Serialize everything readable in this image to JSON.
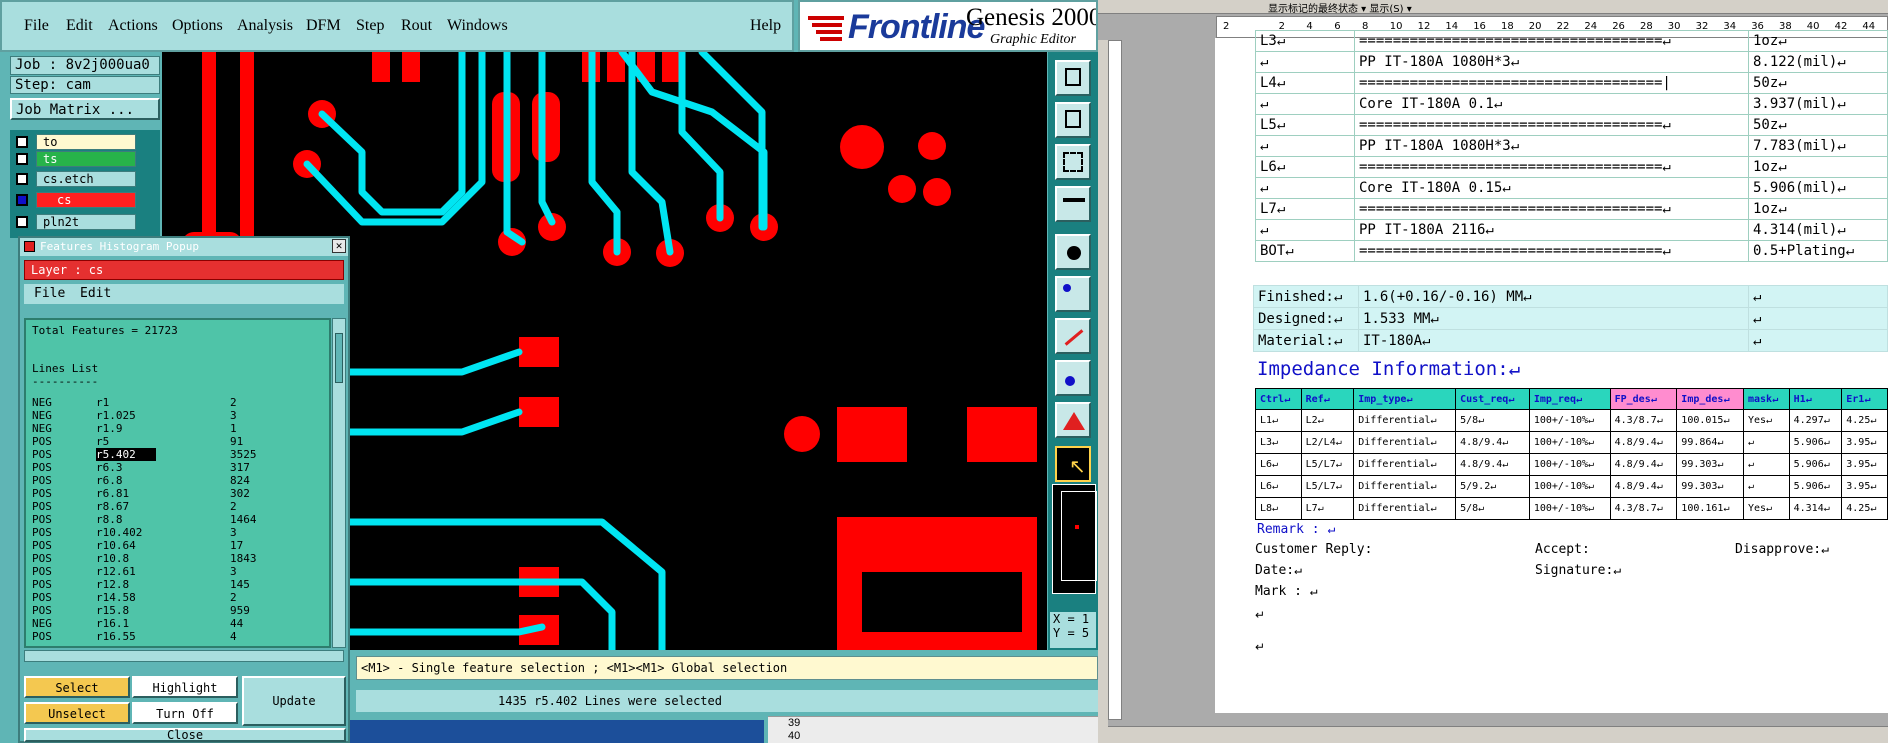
{
  "menubar": {
    "items": [
      "File",
      "Edit",
      "Actions",
      "Options",
      "Analysis",
      "DFM",
      "Step",
      "Rout",
      "Windows"
    ],
    "help": "Help"
  },
  "branding": {
    "logo": "Frontline",
    "title": "Genesis 2000",
    "subtitle": "Graphic Editor"
  },
  "job": {
    "job_label": "Job : 8v2j000ua0",
    "step_label": "Step: cam",
    "matrix_button": "Job Matrix ..."
  },
  "layers": [
    {
      "name": "to",
      "selected": false
    },
    {
      "name": "ts",
      "selected": false
    },
    {
      "name": "cs.etch",
      "selected": false
    },
    {
      "name": "cs",
      "selected": true
    },
    {
      "name": "pln2t",
      "selected": false
    }
  ],
  "popup": {
    "title": "Features Histogram Popup",
    "layer": "Layer : cs",
    "menu": [
      "File",
      "Edit"
    ],
    "total": "Total Features = 21723",
    "list_title": "Lines List",
    "list_rule": "----------",
    "rows": [
      [
        "NEG",
        "r1",
        "2"
      ],
      [
        "NEG",
        "r1.025",
        "3"
      ],
      [
        "NEG",
        "r1.9",
        "1"
      ],
      [
        "POS",
        "r5",
        "91"
      ],
      [
        "POS",
        "r5.402",
        "3525"
      ],
      [
        "POS",
        "r6.3",
        "317"
      ],
      [
        "POS",
        "r6.8",
        "824"
      ],
      [
        "POS",
        "r6.81",
        "302"
      ],
      [
        "POS",
        "r8.67",
        "2"
      ],
      [
        "POS",
        "r8.8",
        "1464"
      ],
      [
        "POS",
        "r10.402",
        "3"
      ],
      [
        "POS",
        "r10.64",
        "17"
      ],
      [
        "POS",
        "r10.8",
        "1843"
      ],
      [
        "POS",
        "r12.61",
        "3"
      ],
      [
        "POS",
        "r12.8",
        "145"
      ],
      [
        "POS",
        "r14.58",
        "2"
      ],
      [
        "POS",
        "r15.8",
        "959"
      ],
      [
        "NEG",
        "r16.1",
        "44"
      ],
      [
        "POS",
        "r16.55",
        "4"
      ]
    ],
    "selected_row": 4,
    "buttons": {
      "select": "Select",
      "highlight": "Highlight",
      "update": "Update",
      "unselect": "Unselect",
      "turn_off": "Turn Off",
      "close": "Close"
    }
  },
  "coords": {
    "x_label": "X = 1",
    "y_label": "Y = 5"
  },
  "prompt": "<M1> - Single feature selection ; <M1><M1> Global selection",
  "status": "1435 r5.402 Lines were selected",
  "sheet_rows": [
    "39",
    "40"
  ],
  "word": {
    "toolbar_text": "显示标记的最终状态 ▾  显示(S) ▾",
    "ruler_ticks": [
      "2",
      "",
      "2",
      "4",
      "6",
      "8",
      "10",
      "12",
      "14",
      "16",
      "18",
      "20",
      "22",
      "24",
      "26",
      "28",
      "30",
      "32",
      "34",
      "36",
      "38",
      "40",
      "42",
      "44"
    ],
    "stackup": [
      [
        "L3↵",
        "====================================↵",
        "1oz↵"
      ],
      [
        "↵",
        "PP     IT-180A     1080H*3↵",
        "8.122(mil)↵"
      ],
      [
        "L4↵",
        "====================================|",
        "50z↵"
      ],
      [
        "↵",
        "Core    IT-180A    0.1↵",
        "3.937(mil)↵"
      ],
      [
        "L5↵",
        "====================================↵",
        "50z↵"
      ],
      [
        "↵",
        "PP     IT-180A     1080H*3↵",
        "7.783(mil)↵"
      ],
      [
        "L6↵",
        "====================================↵",
        "1oz↵"
      ],
      [
        "↵",
        "Core    IT-180A    0.15↵",
        "5.906(mil)↵"
      ],
      [
        "L7↵",
        "====================================↵",
        "1oz↵"
      ],
      [
        "↵",
        "PP     IT-180A     2116↵",
        "4.314(mil)↵"
      ],
      [
        "BOT↵",
        "====================================↵",
        "0.5+Plating↵"
      ]
    ],
    "info": [
      [
        "Finished:↵",
        "1.6(+0.16/-0.16) MM↵",
        "↵"
      ],
      [
        "Designed:↵",
        "1.533 MM↵",
        "↵"
      ],
      [
        "Material:↵",
        "IT-180A↵",
        "↵"
      ]
    ],
    "impedance_title": "Impedance Information:↵",
    "impedance_headers": [
      "Ctrl↵",
      "Ref↵",
      "Imp_type↵",
      "Cust_req↵",
      "Imp_req↵",
      "FP_des↵",
      "Imp_des↵",
      "mask↵",
      "H1↵",
      "Er1↵"
    ],
    "impedance_rows": [
      [
        "L1↵",
        "L2↵",
        "Differential↵",
        "5/8↵",
        "100+/-10%↵",
        "4.3/8.7↵",
        "100.015↵",
        "Yes↵",
        "4.297↵",
        "4.25↵"
      ],
      [
        "L3↵",
        "L2/L4↵",
        "Differential↵",
        "4.8/9.4↵",
        "100+/-10%↵",
        "4.8/9.4↵",
        "99.864↵",
        "↵",
        "5.906↵",
        "3.95↵"
      ],
      [
        "L6↵",
        "L5/L7↵",
        "Differential↵",
        "4.8/9.4↵",
        "100+/-10%↵",
        "4.8/9.4↵",
        "99.303↵",
        "↵",
        "5.906↵",
        "3.95↵"
      ],
      [
        "L6↵",
        "L5/L7↵",
        "Differential↵",
        "5/9.2↵",
        "100+/-10%↵",
        "4.8/9.4↵",
        "99.303↵",
        "↵",
        "5.906↵",
        "3.95↵"
      ],
      [
        "L8↵",
        "L7↵",
        "Differential↵",
        "5/8↵",
        "100+/-10%↵",
        "4.3/8.7↵",
        "100.161↵",
        "Yes↵",
        "4.314↵",
        "4.25↵"
      ]
    ],
    "remark": "Remark : ↵",
    "customer_reply": "Customer Reply:",
    "accept": "Accept:",
    "disapprove": "Disapprove:↵",
    "date": "Date:↵",
    "signature": "Signature:↵",
    "mark": "Mark : ↵",
    "para_marks": [
      "↵",
      "↵"
    ]
  },
  "colors": {
    "genesis_bg": "#5fb5b5",
    "panel": "#a9dede",
    "trace_red": "#ff0000",
    "trace_cyan": "#00e5f2",
    "select_yellow": "#f4c850",
    "word_header": "#2ad6bd"
  }
}
